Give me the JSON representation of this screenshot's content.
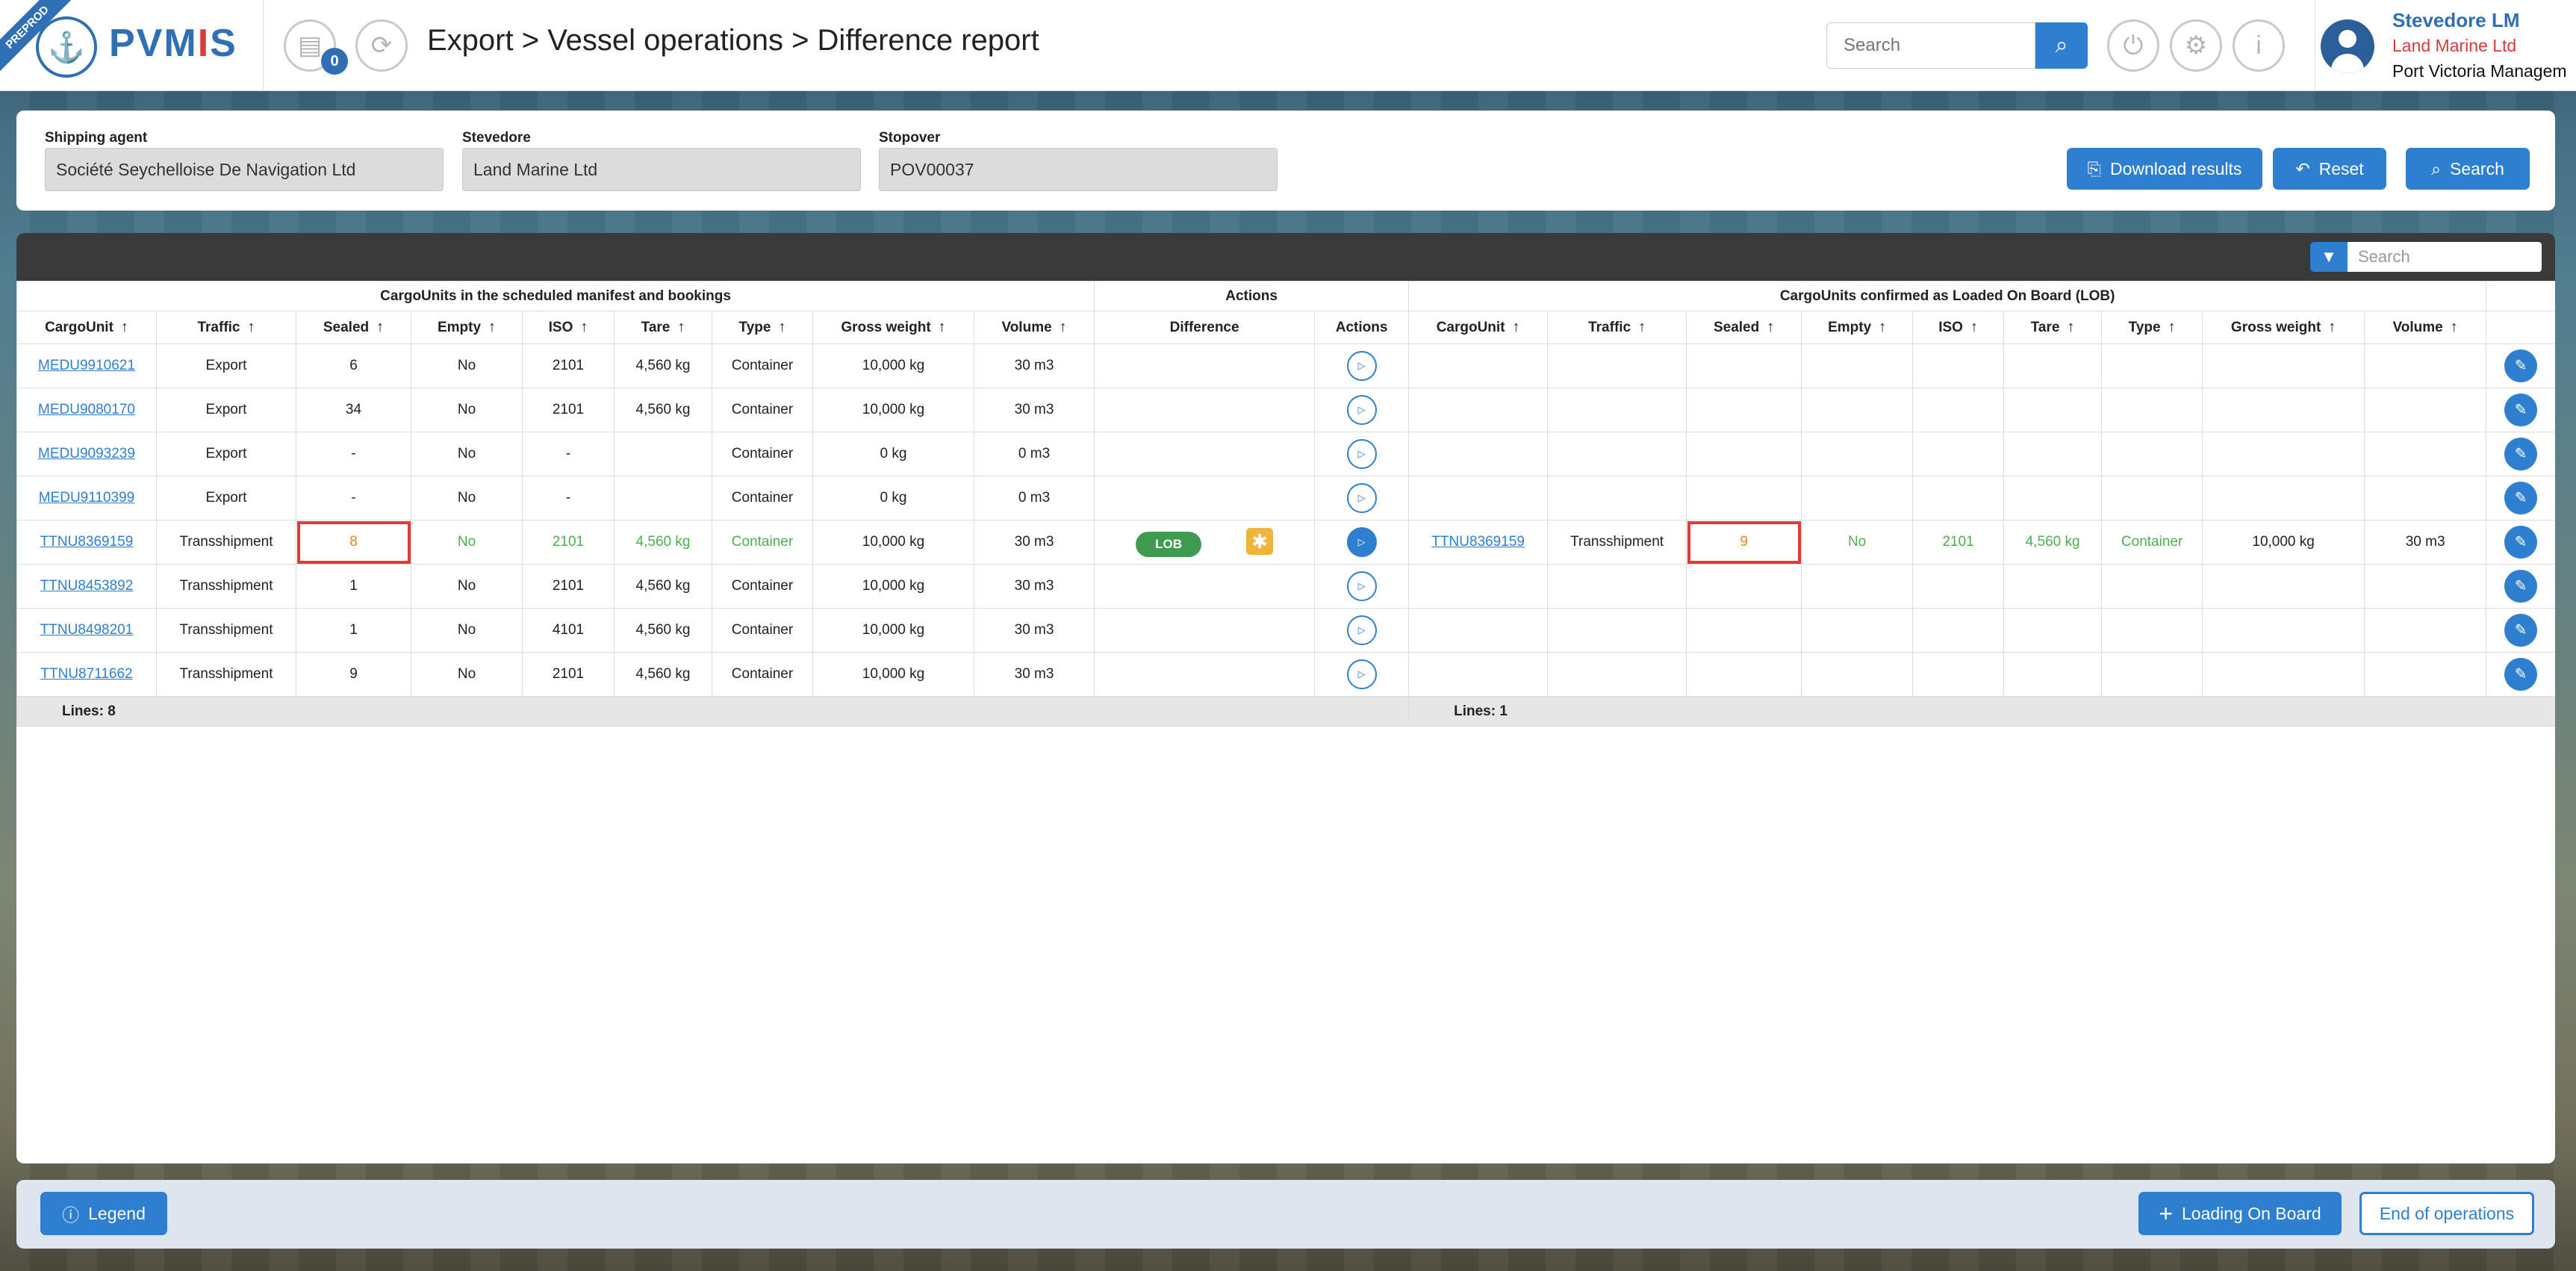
{
  "header": {
    "env_ribbon": "PREPROD",
    "logo_text_1": "PVM",
    "logo_text_2": "I",
    "logo_text_3": "S",
    "notif_count": "0",
    "breadcrumb": "Export > Vessel operations > Difference report",
    "search_placeholder": "Search",
    "user_name": "Stevedore LM",
    "user_company": "Land Marine Ltd",
    "user_org": "Port Victoria Managem"
  },
  "filters": {
    "shipping_agent_label": "Shipping agent",
    "shipping_agent_value": "Société Seychelloise De Navigation Ltd",
    "stevedore_label": "Stevedore",
    "stevedore_value": "Land Marine Ltd",
    "stopover_label": "Stopover",
    "stopover_value": "POV00037",
    "download_label": "Download results",
    "reset_label": "Reset",
    "search_label": "Search"
  },
  "table": {
    "search_placeholder": "Search",
    "group_left": "CargoUnits in the scheduled manifest and bookings",
    "group_actions": "Actions",
    "group_right": "CargoUnits confirmed as Loaded On Board (LOB)",
    "headers_left": [
      "CargoUnit",
      "Traffic",
      "Sealed",
      "Empty",
      "ISO",
      "Tare",
      "Type",
      "Gross weight",
      "Volume"
    ],
    "header_difference": "Difference",
    "header_actions": "Actions",
    "headers_right": [
      "CargoUnit",
      "Traffic",
      "Sealed",
      "Empty",
      "ISO",
      "Tare",
      "Type",
      "Gross weight",
      "Volume"
    ],
    "rows": [
      {
        "left": [
          "MEDU9910621",
          "Export",
          "6",
          "No",
          "2101",
          "4,560 kg",
          "Container",
          "10,000 kg",
          "30 m3"
        ],
        "diff": "",
        "right": [
          "",
          "",
          "",
          "",
          "",
          "",
          "",
          "",
          ""
        ]
      },
      {
        "left": [
          "MEDU9080170",
          "Export",
          "34",
          "No",
          "2101",
          "4,560 kg",
          "Container",
          "10,000 kg",
          "30 m3"
        ],
        "diff": "",
        "right": [
          "",
          "",
          "",
          "",
          "",
          "",
          "",
          "",
          ""
        ]
      },
      {
        "left": [
          "MEDU9093239",
          "Export",
          "-",
          "No",
          "-",
          "",
          "Container",
          "0 kg",
          "0 m3"
        ],
        "diff": "",
        "right": [
          "",
          "",
          "",
          "",
          "",
          "",
          "",
          "",
          ""
        ]
      },
      {
        "left": [
          "MEDU9110399",
          "Export",
          "-",
          "No",
          "-",
          "",
          "Container",
          "0 kg",
          "0 m3"
        ],
        "diff": "",
        "right": [
          "",
          "",
          "",
          "",
          "",
          "",
          "",
          "",
          ""
        ]
      },
      {
        "left": [
          "TTNU8369159",
          "Transshipment",
          "8",
          "No",
          "2101",
          "4,560 kg",
          "Container",
          "10,000 kg",
          "30 m3"
        ],
        "diff": "LOB",
        "right": [
          "TTNU8369159",
          "Transshipment",
          "9",
          "No",
          "2101",
          "4,560 kg",
          "Container",
          "10,000 kg",
          "30 m3"
        ]
      },
      {
        "left": [
          "TTNU8453892",
          "Transshipment",
          "1",
          "No",
          "2101",
          "4,560 kg",
          "Container",
          "10,000 kg",
          "30 m3"
        ],
        "diff": "",
        "right": [
          "",
          "",
          "",
          "",
          "",
          "",
          "",
          "",
          ""
        ]
      },
      {
        "left": [
          "TTNU8498201",
          "Transshipment",
          "1",
          "No",
          "4101",
          "4,560 kg",
          "Container",
          "10,000 kg",
          "30 m3"
        ],
        "diff": "",
        "right": [
          "",
          "",
          "",
          "",
          "",
          "",
          "",
          "",
          ""
        ]
      },
      {
        "left": [
          "TTNU8711662",
          "Transshipment",
          "9",
          "No",
          "2101",
          "4,560 kg",
          "Container",
          "10,000 kg",
          "30 m3"
        ],
        "diff": "",
        "right": [
          "",
          "",
          "",
          "",
          "",
          "",
          "",
          "",
          ""
        ]
      }
    ],
    "lines_left": "Lines: 8",
    "lines_right": "Lines: 1"
  },
  "footer": {
    "legend_label": "Legend",
    "loading_label": "Loading On Board",
    "end_label": "End of operations"
  },
  "colors": {
    "primary": "#2f7fd0",
    "brand": "#2f6fb5",
    "alert_red": "#e53935",
    "match_green": "#4caf50",
    "diff_orange": "#e08a1e"
  },
  "icons": [
    "anchor-logo-icon",
    "document-icon",
    "refresh-icon",
    "search-icon",
    "power-icon",
    "settings-icon",
    "info-icon",
    "user-avatar-icon",
    "file-download-icon",
    "reset-icon",
    "filter-icon",
    "play-icon",
    "edit-icon",
    "star-icon",
    "info-circle-icon",
    "plus-icon"
  ]
}
